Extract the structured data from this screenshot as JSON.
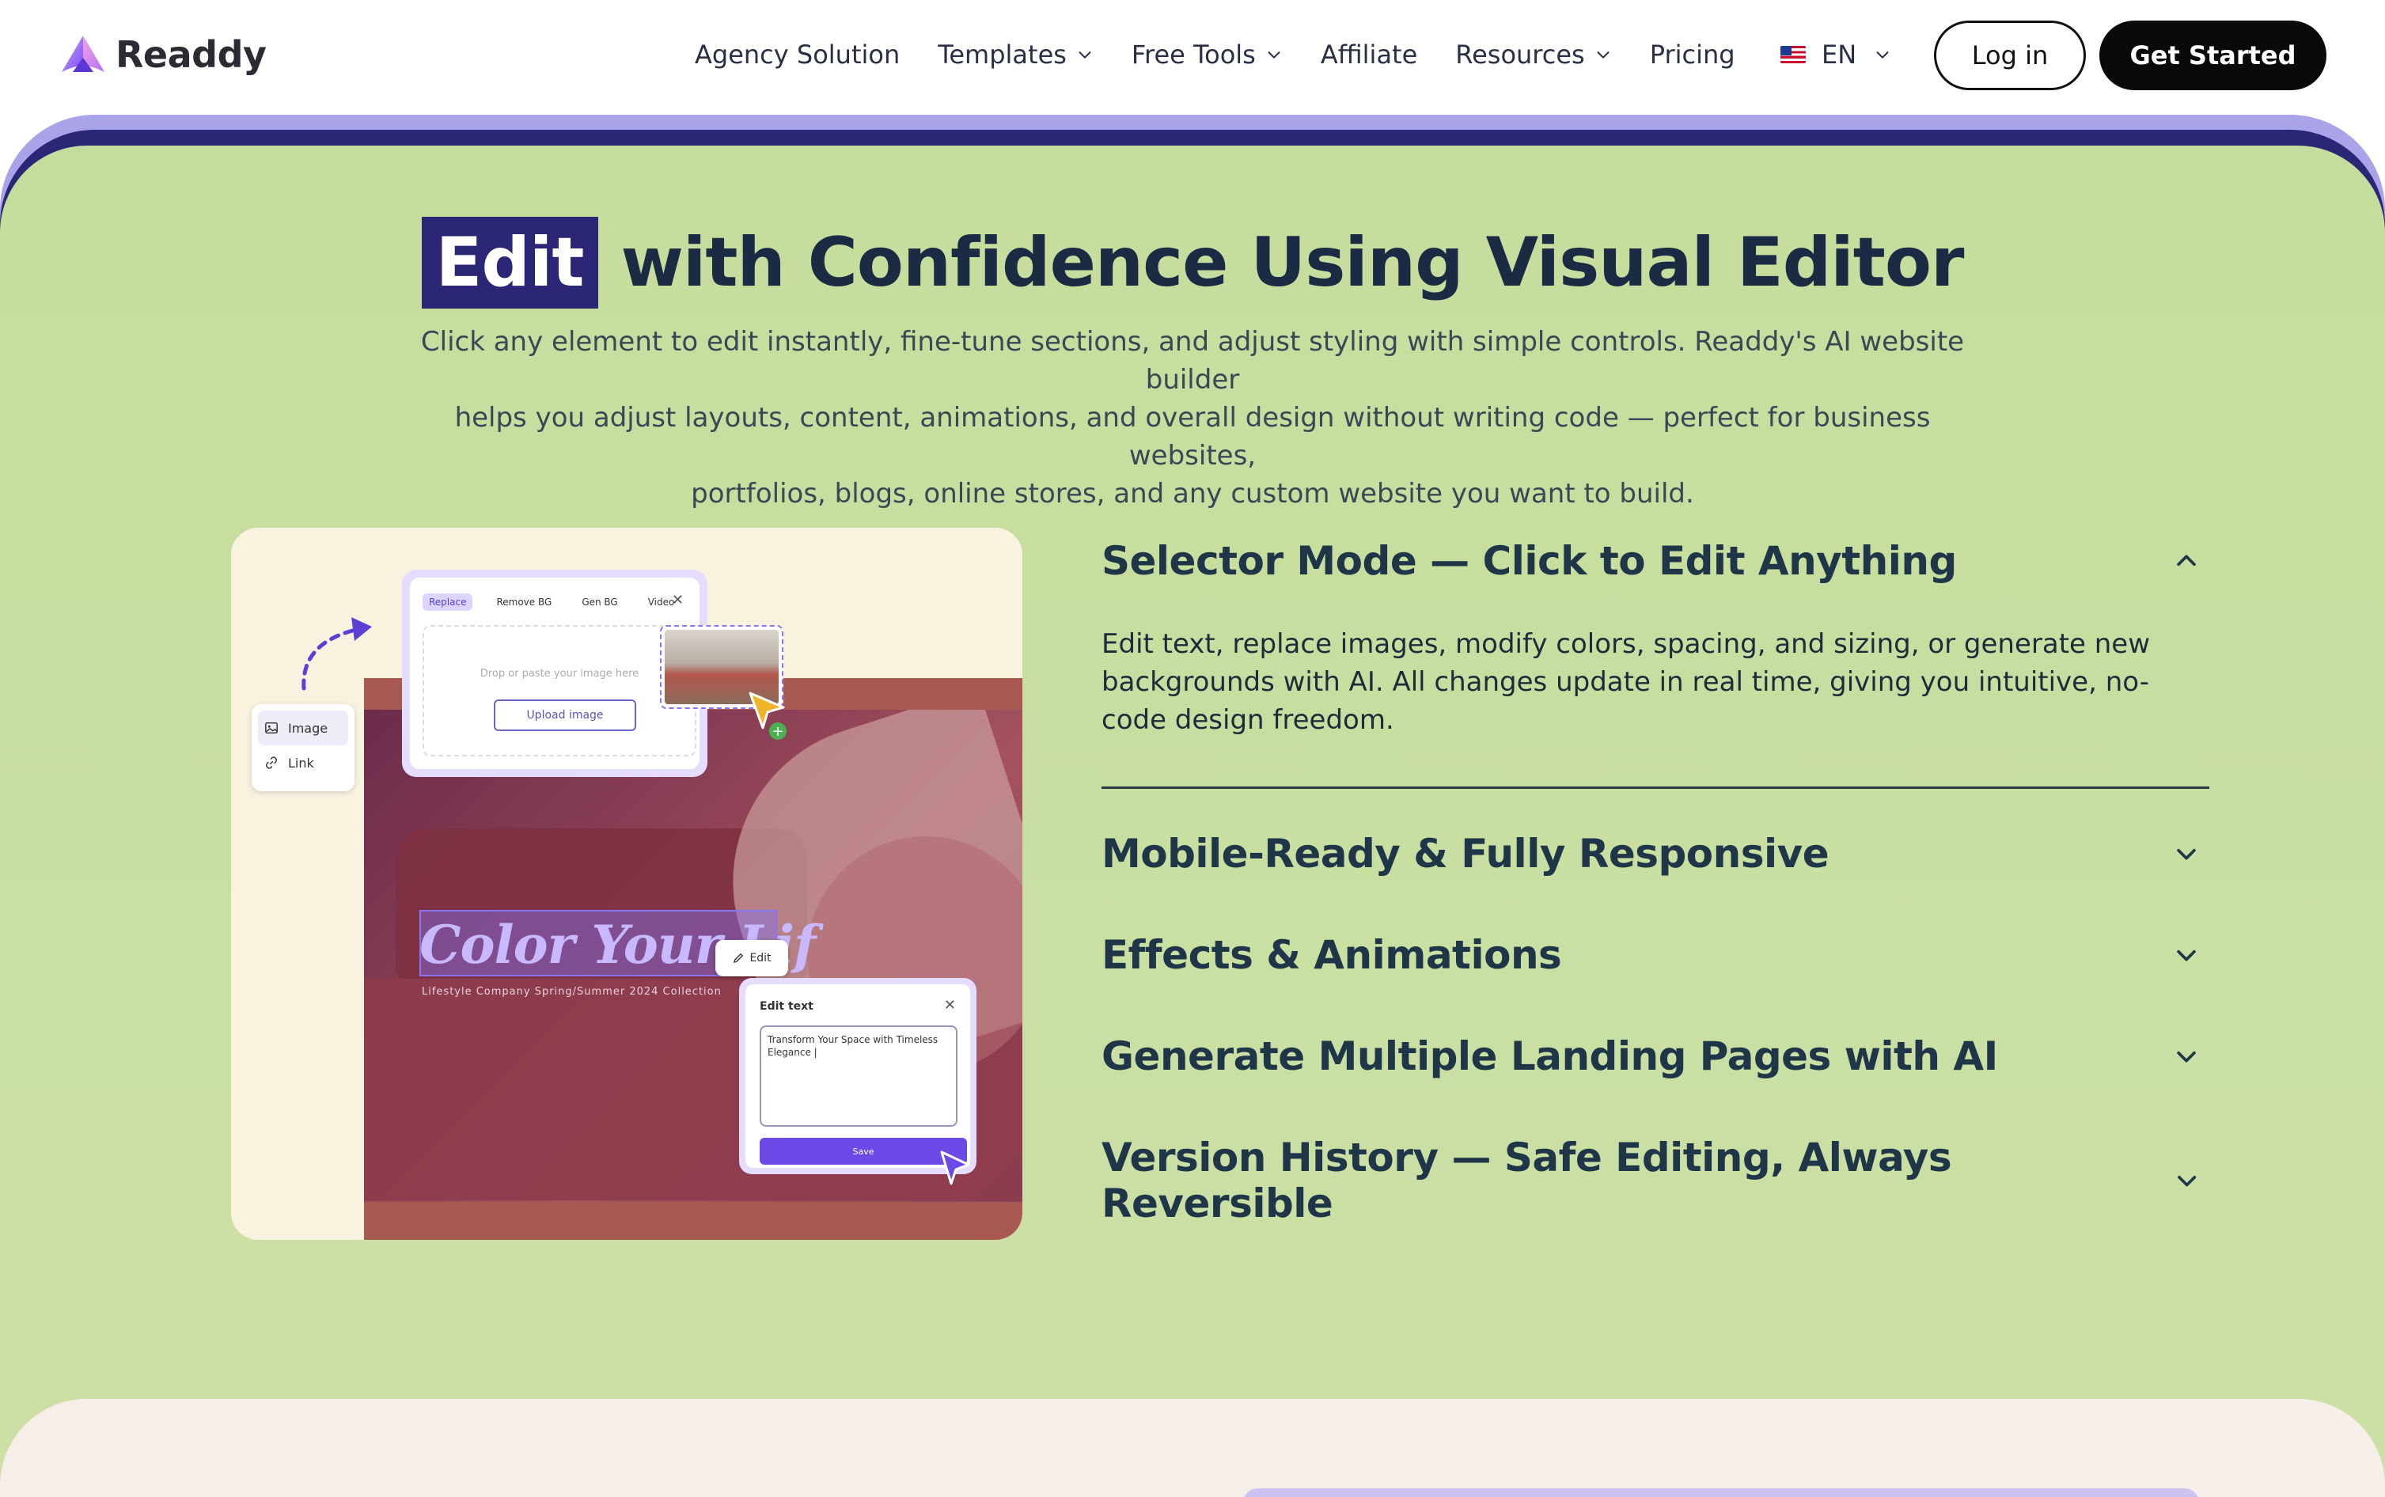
{
  "nav": {
    "logo_text": "Readdy",
    "links": [
      {
        "label": "Agency Solution",
        "has_dropdown": false
      },
      {
        "label": "Templates",
        "has_dropdown": true
      },
      {
        "label": "Free Tools",
        "has_dropdown": true
      },
      {
        "label": "Affiliate",
        "has_dropdown": false
      },
      {
        "label": "Resources",
        "has_dropdown": true
      },
      {
        "label": "Pricing",
        "has_dropdown": false
      }
    ],
    "language": "EN",
    "login_label": "Log in",
    "cta_label": "Get Started"
  },
  "hero": {
    "headline_highlight": "Edit",
    "headline_rest": "with Confidence Using Visual Editor",
    "subtitle_lines": [
      "Click any element to edit instantly, fine-tune sections, and adjust styling with simple controls. Readdy's AI website builder",
      "helps you adjust layouts, content, animations, and overall design without writing code — perfect for business websites,",
      "portfolios, blogs, online stores, and any custom website you want to build."
    ]
  },
  "illustration": {
    "upload_tabs": [
      "Replace",
      "Remove BG",
      "Gen BG",
      "Video"
    ],
    "drop_text": "Drop or paste your image here",
    "upload_button": "Upload image",
    "side_panel_items": [
      "Image",
      "Link"
    ],
    "headline_text": "Color Your Lif",
    "tagline": "Lifestyle Company Spring/Summer 2024 Collection",
    "edit_chip": "Edit",
    "edit_panel_title": "Edit text",
    "edit_panel_text": "Transform Your Space with Timeless Elegance |",
    "save_label": "Save",
    "close_symbol": "✕"
  },
  "features": {
    "items": [
      {
        "title": "Selector Mode — Click to Edit Anything",
        "expanded": true,
        "body": "Edit text, replace images, modify colors, spacing, and sizing, or generate new backgrounds with AI. All changes update in real time, giving you intuitive, no-code design freedom."
      },
      {
        "title": "Mobile-Ready & Fully Responsive",
        "expanded": false
      },
      {
        "title": "Effects & Animations",
        "expanded": false
      },
      {
        "title": "Generate Multiple Landing Pages with AI",
        "expanded": false
      },
      {
        "title": "Version History — Safe Editing, Always Reversible",
        "expanded": false
      }
    ]
  },
  "colors": {
    "accent_navy": "#2b2676",
    "section_green": "#c8de9f",
    "button_black": "#0a0a0a",
    "heading_text": "#1c2b44",
    "brand_purple": "#6b4ae8"
  },
  "icons": {
    "nav_dropdown": "chevron-down-icon",
    "accordion_open": "chevron-up-icon",
    "accordion_closed": "chevron-down-icon",
    "language_flag": "us-flag-icon"
  }
}
